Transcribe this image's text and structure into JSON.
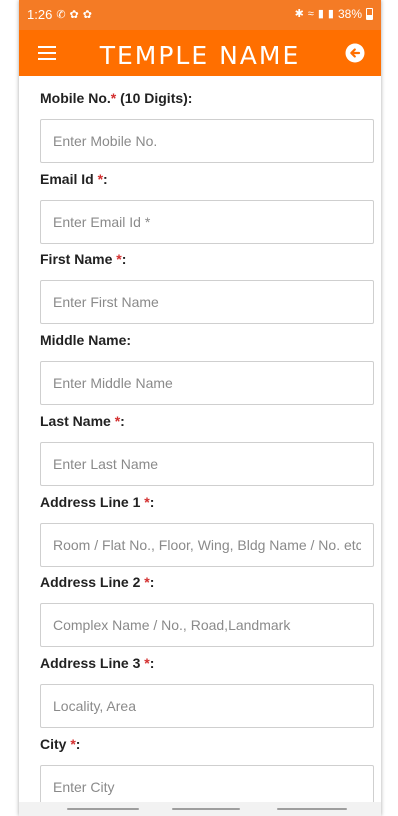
{
  "status_bar": {
    "time": "1:26",
    "battery": "38%",
    "icons_left": [
      "whatsapp-icon",
      "notification-icon",
      "notification-icon"
    ],
    "icons_right": [
      "bluetooth-icon",
      "wifi-icon",
      "volte-signal-icon",
      "volte-signal-icon"
    ]
  },
  "app_bar": {
    "title": "TEMPLE NAME",
    "background": "#ff6f00"
  },
  "form": {
    "fields": [
      {
        "label": "Mobile No.",
        "required": "*",
        "suffix": " (10 Digits):",
        "placeholder": "Enter Mobile No."
      },
      {
        "label": "Email Id ",
        "required": "*",
        "suffix": ":",
        "placeholder": "Enter Email Id *"
      },
      {
        "label": "First Name ",
        "required": "*",
        "suffix": ":",
        "placeholder": "Enter First Name"
      },
      {
        "label": "Middle Name:",
        "required": "",
        "suffix": "",
        "placeholder": "Enter Middle Name"
      },
      {
        "label": "Last Name ",
        "required": "*",
        "suffix": ":",
        "placeholder": "Enter Last Name"
      },
      {
        "label": "Address Line 1 ",
        "required": "*",
        "suffix": ":",
        "placeholder": "Room / Flat No., Floor, Wing, Bldg Name / No. etc"
      },
      {
        "label": "Address Line 2 ",
        "required": "*",
        "suffix": ":",
        "placeholder": "Complex Name / No., Road,Landmark"
      },
      {
        "label": "Address Line 3 ",
        "required": "*",
        "suffix": ":",
        "placeholder": "Locality, Area"
      },
      {
        "label": "City ",
        "required": "*",
        "suffix": ":",
        "placeholder": "Enter City"
      }
    ]
  },
  "colors": {
    "status_bar": "#f47b25",
    "accent": "#ff6f00",
    "required": "#d32f2f"
  }
}
